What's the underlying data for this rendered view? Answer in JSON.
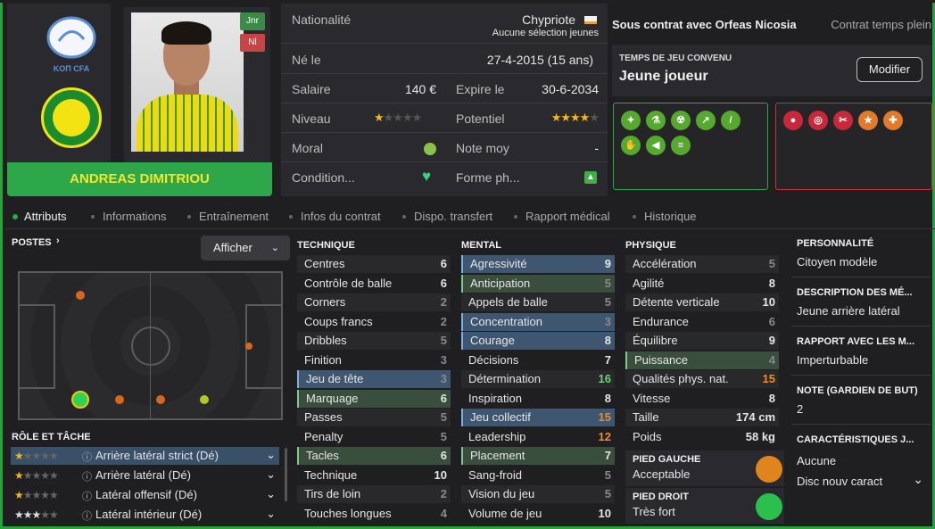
{
  "header": {
    "club_crest_text": "KOΠ CFA",
    "player_name": "ANDREAS DIMITRIOU",
    "badge_jnr": "Jnr",
    "badge_nl": "Nl"
  },
  "info": {
    "nationality_label": "Nationalité",
    "nationality_value": "Chypriote",
    "nationality_sub": "Aucune sélection jeunes",
    "born_label": "Né le",
    "born_value": "27-4-2015 (15 ans)",
    "salary_label": "Salaire",
    "salary_value": "140 €",
    "expires_label": "Expire le",
    "expires_value": "30-6-2034",
    "level_label": "Niveau",
    "potential_label": "Potentiel",
    "morale_label": "Moral",
    "avg_rating_label": "Note moy",
    "avg_rating_value": "-",
    "condition_label": "Condition...",
    "form_label": "Forme ph..."
  },
  "contract": {
    "status": "Sous contrat avec Orfeas Nicosia",
    "type": "Contrat temps plein",
    "playtime_title": "TEMPS DE JEU CONVENU",
    "playtime_value": "Jeune joueur",
    "modify_label": "Modifier"
  },
  "tabs": [
    "Attributs",
    "Informations",
    "Entraînement",
    "Infos du contrat",
    "Dispo. transfert",
    "Rapport médical",
    "Historique"
  ],
  "positions": {
    "title": "POSTES",
    "show_label": "Afficher"
  },
  "roles": {
    "title": "RÔLE ET TÂCHE",
    "items": [
      "Arrière latéral strict (Dé)",
      "Arrière latéral (Dé)",
      "Latéral offensif (Dé)",
      "Latéral intérieur (Dé)"
    ]
  },
  "technique": {
    "title": "TECHNIQUE",
    "rows": [
      [
        "Centres",
        "6"
      ],
      [
        "Contrôle de balle",
        "6"
      ],
      [
        "Corners",
        "2"
      ],
      [
        "Coups francs",
        "2"
      ],
      [
        "Dribbles",
        "5"
      ],
      [
        "Finition",
        "3"
      ],
      [
        "Jeu de tête",
        "3"
      ],
      [
        "Marquage",
        "6"
      ],
      [
        "Passes",
        "5"
      ],
      [
        "Penalty",
        "5"
      ],
      [
        "Tacles",
        "6"
      ],
      [
        "Technique",
        "10"
      ],
      [
        "Tirs de loin",
        "2"
      ],
      [
        "Touches longues",
        "4"
      ]
    ]
  },
  "mental": {
    "title": "MENTAL",
    "rows": [
      [
        "Agressivité",
        "9"
      ],
      [
        "Anticipation",
        "5"
      ],
      [
        "Appels de balle",
        "5"
      ],
      [
        "Concentration",
        "3"
      ],
      [
        "Courage",
        "8"
      ],
      [
        "Décisions",
        "7"
      ],
      [
        "Détermination",
        "16"
      ],
      [
        "Inspiration",
        "8"
      ],
      [
        "Jeu collectif",
        "15"
      ],
      [
        "Leadership",
        "12"
      ],
      [
        "Placement",
        "7"
      ],
      [
        "Sang-froid",
        "5"
      ],
      [
        "Vision du jeu",
        "5"
      ],
      [
        "Volume de jeu",
        "10"
      ]
    ]
  },
  "physique": {
    "title": "PHYSIQUE",
    "rows": [
      [
        "Accélération",
        "5"
      ],
      [
        "Agilité",
        "8"
      ],
      [
        "Détente verticale",
        "10"
      ],
      [
        "Endurance",
        "6"
      ],
      [
        "Équilibre",
        "9"
      ],
      [
        "Puissance",
        "4"
      ],
      [
        "Qualités phys. nat.",
        "15"
      ],
      [
        "Vitesse",
        "8"
      ],
      [
        "Taille",
        "174 cm"
      ],
      [
        "Poids",
        "58 kg"
      ]
    ]
  },
  "feet": {
    "left_title": "PIED GAUCHE",
    "left_value": "Acceptable",
    "right_title": "PIED DROIT",
    "right_value": "Très fort"
  },
  "side": {
    "personality_title": "PERSONNALITÉ",
    "personality_value": "Citoyen modèle",
    "desc_title": "DESCRIPTION DES MÉ...",
    "desc_value": "Jeune arrière latéral",
    "media_title": "RAPPORT AVEC LES M...",
    "media_value": "Imperturbable",
    "gk_title": "NOTE (GARDIEN DE BUT)",
    "gk_value": "2",
    "traits_title": "CARACTÉRISTIQUES J...",
    "traits_value1": "Aucune",
    "traits_value2": "Disc nouv caract"
  }
}
